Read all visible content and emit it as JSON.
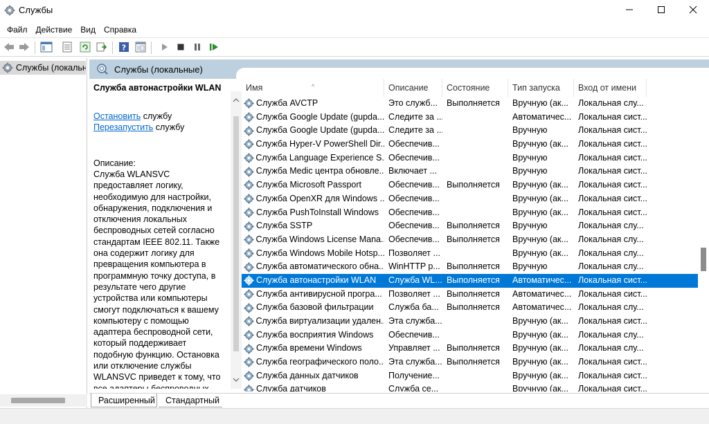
{
  "window": {
    "title": "Службы",
    "icon": "gear-icon",
    "controls": [
      "minimize-icon",
      "maximize-icon",
      "close-icon"
    ]
  },
  "menu": [
    "Файл",
    "Действие",
    "Вид",
    "Справка"
  ],
  "toolbar": {
    "icons": [
      "back-arrow-icon",
      "forward-arrow-icon",
      "console-tree-icon",
      "properties-icon",
      "refresh-icon",
      "export-icon",
      "help-icon",
      "view-icon",
      "play-icon",
      "stop-icon",
      "pause-icon",
      "restart-icon"
    ]
  },
  "tree": {
    "selected": "Службы (локальн"
  },
  "pane": {
    "header": "Службы (локальные)"
  },
  "description": {
    "title": "Служба автонастройки WLAN",
    "stop_link": "Остановить",
    "stop_suffix": " службу",
    "restart_link": "Перезапустить",
    "restart_suffix": " службу",
    "label": "Описание:",
    "text": "Служба WLANSVC предоставляет логику, необходимую для настройки, обнаружения, подключения и отключения локальных беспроводных сетей согласно стандартам IEEE 802.11. Также она содержит логику для превращения компьютера в программную точку доступа, в результате чего другие устройства или компьютеры смогут подключаться к вашему компьютеру с помощью адаптера беспроводной сети, который поддерживает подобную функцию. Остановка или отключение службы WLANSVC приведет к тому, что все адаптеры беспроводных сетей на этом компьютере станут недоступными из раздела"
  },
  "table": {
    "columns": [
      "Имя",
      "Описание",
      "Состояние",
      "Тип запуска",
      "Вход от имени"
    ],
    "sort_indicator": "^",
    "rows": [
      {
        "name": "Служба AVCTP",
        "desc": "Это служб...",
        "state": "Выполняется",
        "start": "Вручную (ак...",
        "logon": "Локальная слу..."
      },
      {
        "name": "Служба Google Update (gupda...",
        "desc": "Следите за ...",
        "state": "",
        "start": "Автоматичес...",
        "logon": "Локальная сист..."
      },
      {
        "name": "Служба Google Update (gupda...",
        "desc": "Следите за ...",
        "state": "",
        "start": "Вручную",
        "logon": "Локальная сист..."
      },
      {
        "name": "Служба Hyper-V PowerShell Dir...",
        "desc": "Обеспечив...",
        "state": "",
        "start": "Вручную (ак...",
        "logon": "Локальная сист..."
      },
      {
        "name": "Служба Language Experience S...",
        "desc": "Обеспечив...",
        "state": "",
        "start": "Вручную",
        "logon": "Локальная сист..."
      },
      {
        "name": "Служба Medic центра обновле...",
        "desc": "Включает ...",
        "state": "",
        "start": "Вручную",
        "logon": "Локальная сист..."
      },
      {
        "name": "Служба Microsoft Passport",
        "desc": "Обеспечив...",
        "state": "Выполняется",
        "start": "Вручную (ак...",
        "logon": "Локальная сист..."
      },
      {
        "name": "Служба OpenXR для Windows ...",
        "desc": "Обеспечив...",
        "state": "",
        "start": "Вручную (ак...",
        "logon": "Локальная сист..."
      },
      {
        "name": "Служба PushToInstall Windows",
        "desc": "Обеспечив...",
        "state": "",
        "start": "Вручную (ак...",
        "logon": "Локальная сист..."
      },
      {
        "name": "Служба SSTP",
        "desc": "Обеспечив...",
        "state": "Выполняется",
        "start": "Вручную",
        "logon": "Локальная слу..."
      },
      {
        "name": "Служба Windows License Mana...",
        "desc": "Обеспечив...",
        "state": "Выполняется",
        "start": "Вручную (ак...",
        "logon": "Локальная слу..."
      },
      {
        "name": "Служба Windows Mobile Hotsp...",
        "desc": "Позволяет ...",
        "state": "",
        "start": "Вручную (ак...",
        "logon": "Локальная слу..."
      },
      {
        "name": "Служба автоматического обна...",
        "desc": "WinHTTP р...",
        "state": "Выполняется",
        "start": "Вручную",
        "logon": "Локальная слу..."
      },
      {
        "name": "Служба автонастройки WLAN",
        "desc": "Служба WL...",
        "state": "Выполняется",
        "start": "Автоматичес...",
        "logon": "Локальная сист...",
        "selected": true
      },
      {
        "name": "Служба антивирусной програ...",
        "desc": "Позволяет ...",
        "state": "Выполняется",
        "start": "Автоматичес...",
        "logon": "Локальная сист..."
      },
      {
        "name": "Служба базовой фильтрации",
        "desc": "Служба ба...",
        "state": "Выполняется",
        "start": "Автоматичес...",
        "logon": "Локальная слу..."
      },
      {
        "name": "Служба виртуализации удален...",
        "desc": "Эта служба...",
        "state": "",
        "start": "Вручную (ак...",
        "logon": "Локальная сист..."
      },
      {
        "name": "Служба восприятия Windows",
        "desc": "Обеспечив...",
        "state": "",
        "start": "Вручную (ак...",
        "logon": "Локальная слу..."
      },
      {
        "name": "Служба времени Windows",
        "desc": "Управляет ...",
        "state": "Выполняется",
        "start": "Вручную (ак...",
        "logon": "Локальная слу..."
      },
      {
        "name": "Служба географического поло...",
        "desc": "Эта служба...",
        "state": "Выполняется",
        "start": "Вручную (ак...",
        "logon": "Локальная сист..."
      },
      {
        "name": "Служба данных датчиков",
        "desc": "Получение...",
        "state": "",
        "start": "Вручную (ак...",
        "logon": "Локальная сист..."
      },
      {
        "name": "Служба датчиков",
        "desc": "Служба се...",
        "state": "",
        "start": "Вручную (ак...",
        "logon": "Локальная сист..."
      }
    ]
  },
  "tabs": [
    "Расширенный",
    "Стандартный"
  ],
  "colors": {
    "accent": "#0078d7",
    "header_band": "#bdd0df",
    "link": "#0066cc"
  }
}
